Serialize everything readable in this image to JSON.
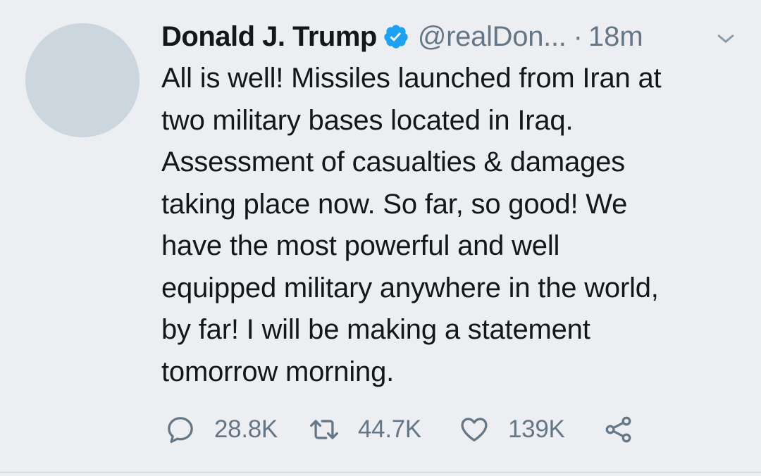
{
  "tweet": {
    "display_name": "Donald J. Trump",
    "verified_icon": "verified-badge-icon",
    "handle": "@realDon...",
    "separator": "·",
    "time": "18m",
    "text": "All is well! Missiles launched from Iran at\ntwo military bases located in Iraq.\nAssessment of casualties & damages\ntaking place now. So far, so good! We\nhave the most powerful and well\nequipped military anywhere in the world,\nby far! I will be making a statement\ntomorrow morning.",
    "actions": {
      "reply_count": "28.8K",
      "retweet_count": "44.7K",
      "like_count": "139K",
      "reply_icon": "reply-icon",
      "retweet_icon": "retweet-icon",
      "like_icon": "heart-icon",
      "share_icon": "share-icon"
    }
  },
  "colors": {
    "background": "#eceef1",
    "text": "#14171a",
    "secondary_text": "#657786",
    "verified": "#1da1f2",
    "avatar_placeholder": "#cbd6de"
  }
}
